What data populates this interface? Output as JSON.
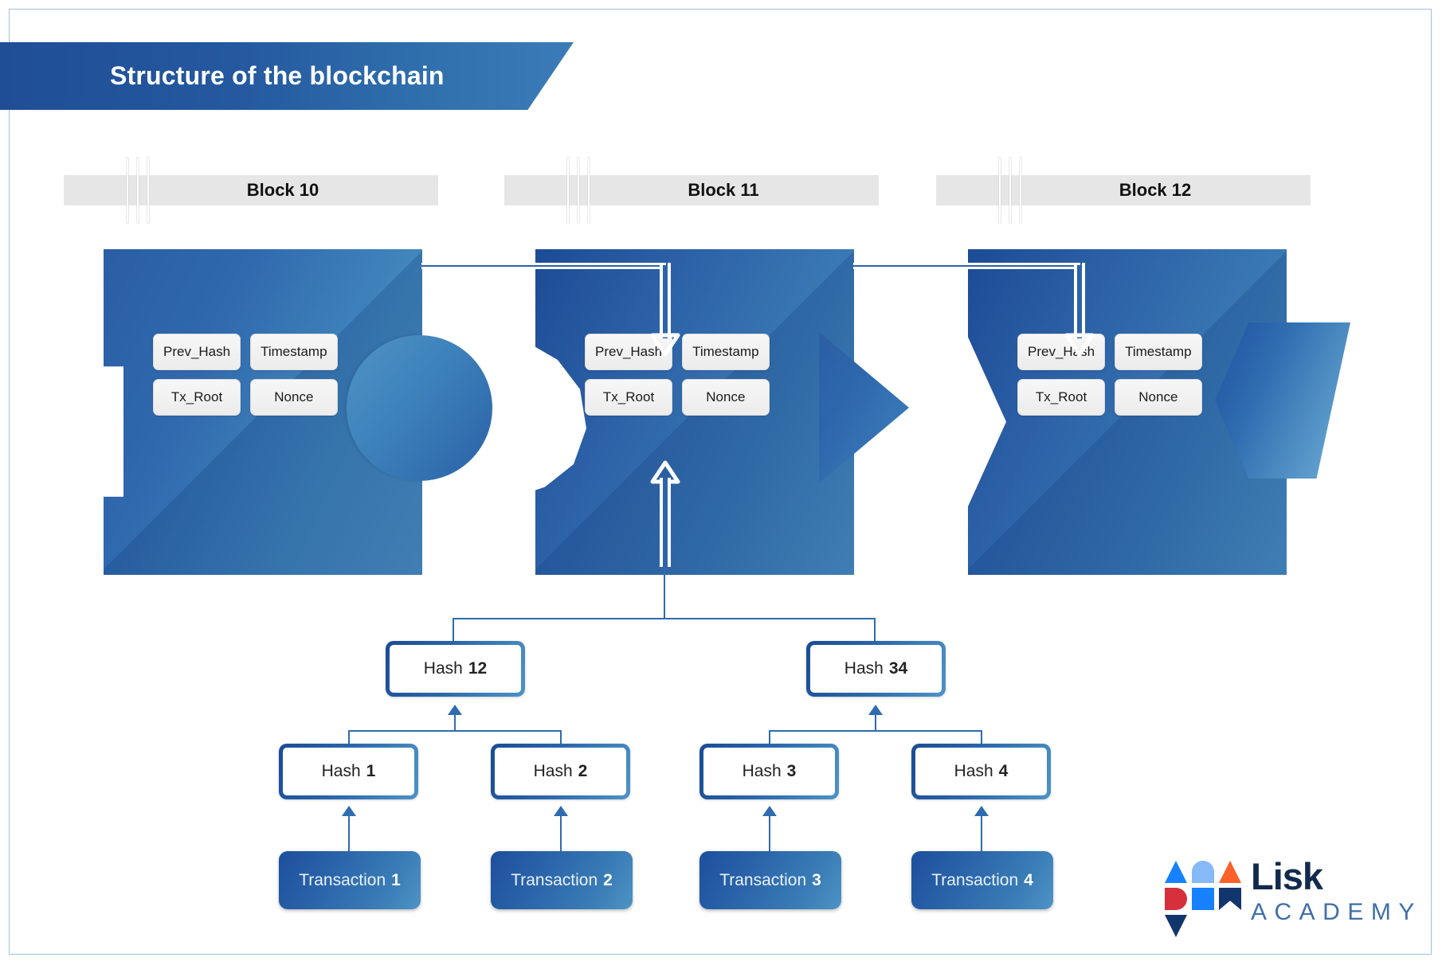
{
  "page": {
    "title": "Structure of the blockchain",
    "border_color": "#9ec0df",
    "banner_gradient_from": "#1f4e96",
    "banner_gradient_to": "#3b7cb8"
  },
  "blocks": [
    {
      "header": "Block 10",
      "fields": [
        "Prev_Hash",
        "Timestamp",
        "Tx_Root",
        "Nonce"
      ],
      "right_connector": "circle-knob",
      "left_connector": "square-notch"
    },
    {
      "header": "Block 11",
      "fields": [
        "Prev_Hash",
        "Timestamp",
        "Tx_Root",
        "Nonce"
      ],
      "right_connector": "triangle-knob",
      "left_connector": "circle-notch"
    },
    {
      "header": "Block 12",
      "fields": [
        "Prev_Hash",
        "Timestamp",
        "Tx_Root",
        "Nonce"
      ],
      "right_connector": "hexagon-knob",
      "left_connector": "chevron-notch"
    }
  ],
  "merkle": {
    "level_top": [
      {
        "label": "Hash",
        "num": "12"
      },
      {
        "label": "Hash",
        "num": "34"
      }
    ],
    "level_leaf": [
      {
        "label": "Hash",
        "num": "1"
      },
      {
        "label": "Hash",
        "num": "2"
      },
      {
        "label": "Hash",
        "num": "3"
      },
      {
        "label": "Hash",
        "num": "4"
      }
    ],
    "transactions": [
      {
        "label": "Transaction",
        "num": "1"
      },
      {
        "label": "Transaction",
        "num": "2"
      },
      {
        "label": "Transaction",
        "num": "3"
      },
      {
        "label": "Transaction",
        "num": "4"
      }
    ]
  },
  "logo": {
    "brand": "Lisk",
    "sub": "ACADEMY",
    "mark_colors": {
      "triangle_up_left": "#1781ff",
      "half_circle_top": "#86b9f7",
      "triangle_up_right": "#fb6128",
      "d_red": "#d6303c",
      "square_blue": "#1781ff",
      "m_navy": "#13356e",
      "triangle_down": "#13356e"
    },
    "brand_color": "#132a4e",
    "sub_color": "#3f6fa8"
  }
}
